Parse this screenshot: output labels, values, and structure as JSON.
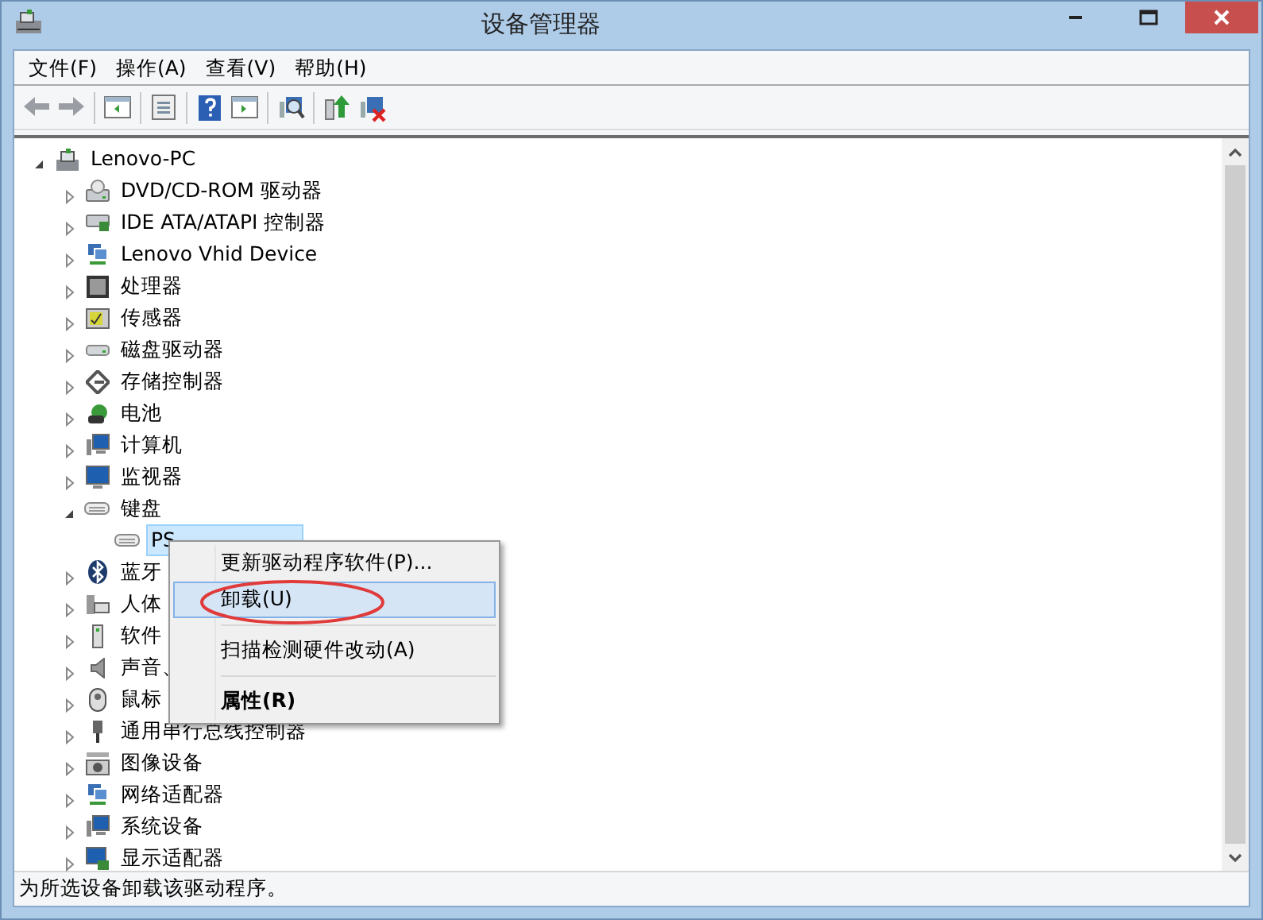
{
  "window": {
    "title": "设备管理器"
  },
  "menu": [
    {
      "label": "文件(F)"
    },
    {
      "label": "操作(A)"
    },
    {
      "label": "查看(V)"
    },
    {
      "label": "帮助(H)"
    }
  ],
  "tree": {
    "label": "Lenovo-PC",
    "expanded": true,
    "selected": false,
    "children": [
      {
        "label": "DVD/CD-ROM 驱动器",
        "expanded": false,
        "selected": false
      },
      {
        "label": "IDE ATA/ATAPI 控制器",
        "expanded": false,
        "selected": false
      },
      {
        "label": "Lenovo Vhid Device",
        "expanded": false,
        "selected": false
      },
      {
        "label": "处理器",
        "expanded": false,
        "selected": false
      },
      {
        "label": "传感器",
        "expanded": false,
        "selected": false
      },
      {
        "label": "磁盘驱动器",
        "expanded": false,
        "selected": false
      },
      {
        "label": "存储控制器",
        "expanded": false,
        "selected": false
      },
      {
        "label": "电池",
        "expanded": false,
        "selected": false
      },
      {
        "label": "计算机",
        "expanded": false,
        "selected": false
      },
      {
        "label": "监视器",
        "expanded": false,
        "selected": false
      },
      {
        "label": "键盘",
        "expanded": true,
        "selected": false,
        "children": [
          {
            "label": "PS",
            "selected": true
          }
        ]
      },
      {
        "label": "蓝牙",
        "expanded": false,
        "selected": false
      },
      {
        "label": "人体",
        "expanded": false,
        "selected": false
      },
      {
        "label": "软件",
        "expanded": false,
        "selected": false
      },
      {
        "label": "声音、",
        "expanded": false,
        "selected": false
      },
      {
        "label": "鼠标",
        "expanded": false,
        "selected": false
      },
      {
        "label": "通用串行总线控制器",
        "expanded": false,
        "selected": false
      },
      {
        "label": "图像设备",
        "expanded": false,
        "selected": false
      },
      {
        "label": "网络适配器",
        "expanded": false,
        "selected": false
      },
      {
        "label": "系统设备",
        "expanded": false,
        "selected": false
      },
      {
        "label": "显示适配器",
        "expanded": false,
        "selected": false
      }
    ]
  },
  "context_menu": {
    "items": [
      {
        "kind": "item",
        "label": "更新驱动程序软件(P)...",
        "highlighted": false,
        "circled": false,
        "default": false
      },
      {
        "kind": "item",
        "label": "卸载(U)",
        "highlighted": true,
        "circled": true,
        "default": false
      },
      {
        "kind": "separator"
      },
      {
        "kind": "item",
        "label": "扫描检测硬件改动(A)",
        "highlighted": false,
        "circled": false,
        "default": false
      },
      {
        "kind": "separator"
      },
      {
        "kind": "item",
        "label": "属性(R)",
        "highlighted": false,
        "circled": false,
        "default": true
      }
    ]
  },
  "status_bar": "为所选设备卸载该驱动程序。"
}
